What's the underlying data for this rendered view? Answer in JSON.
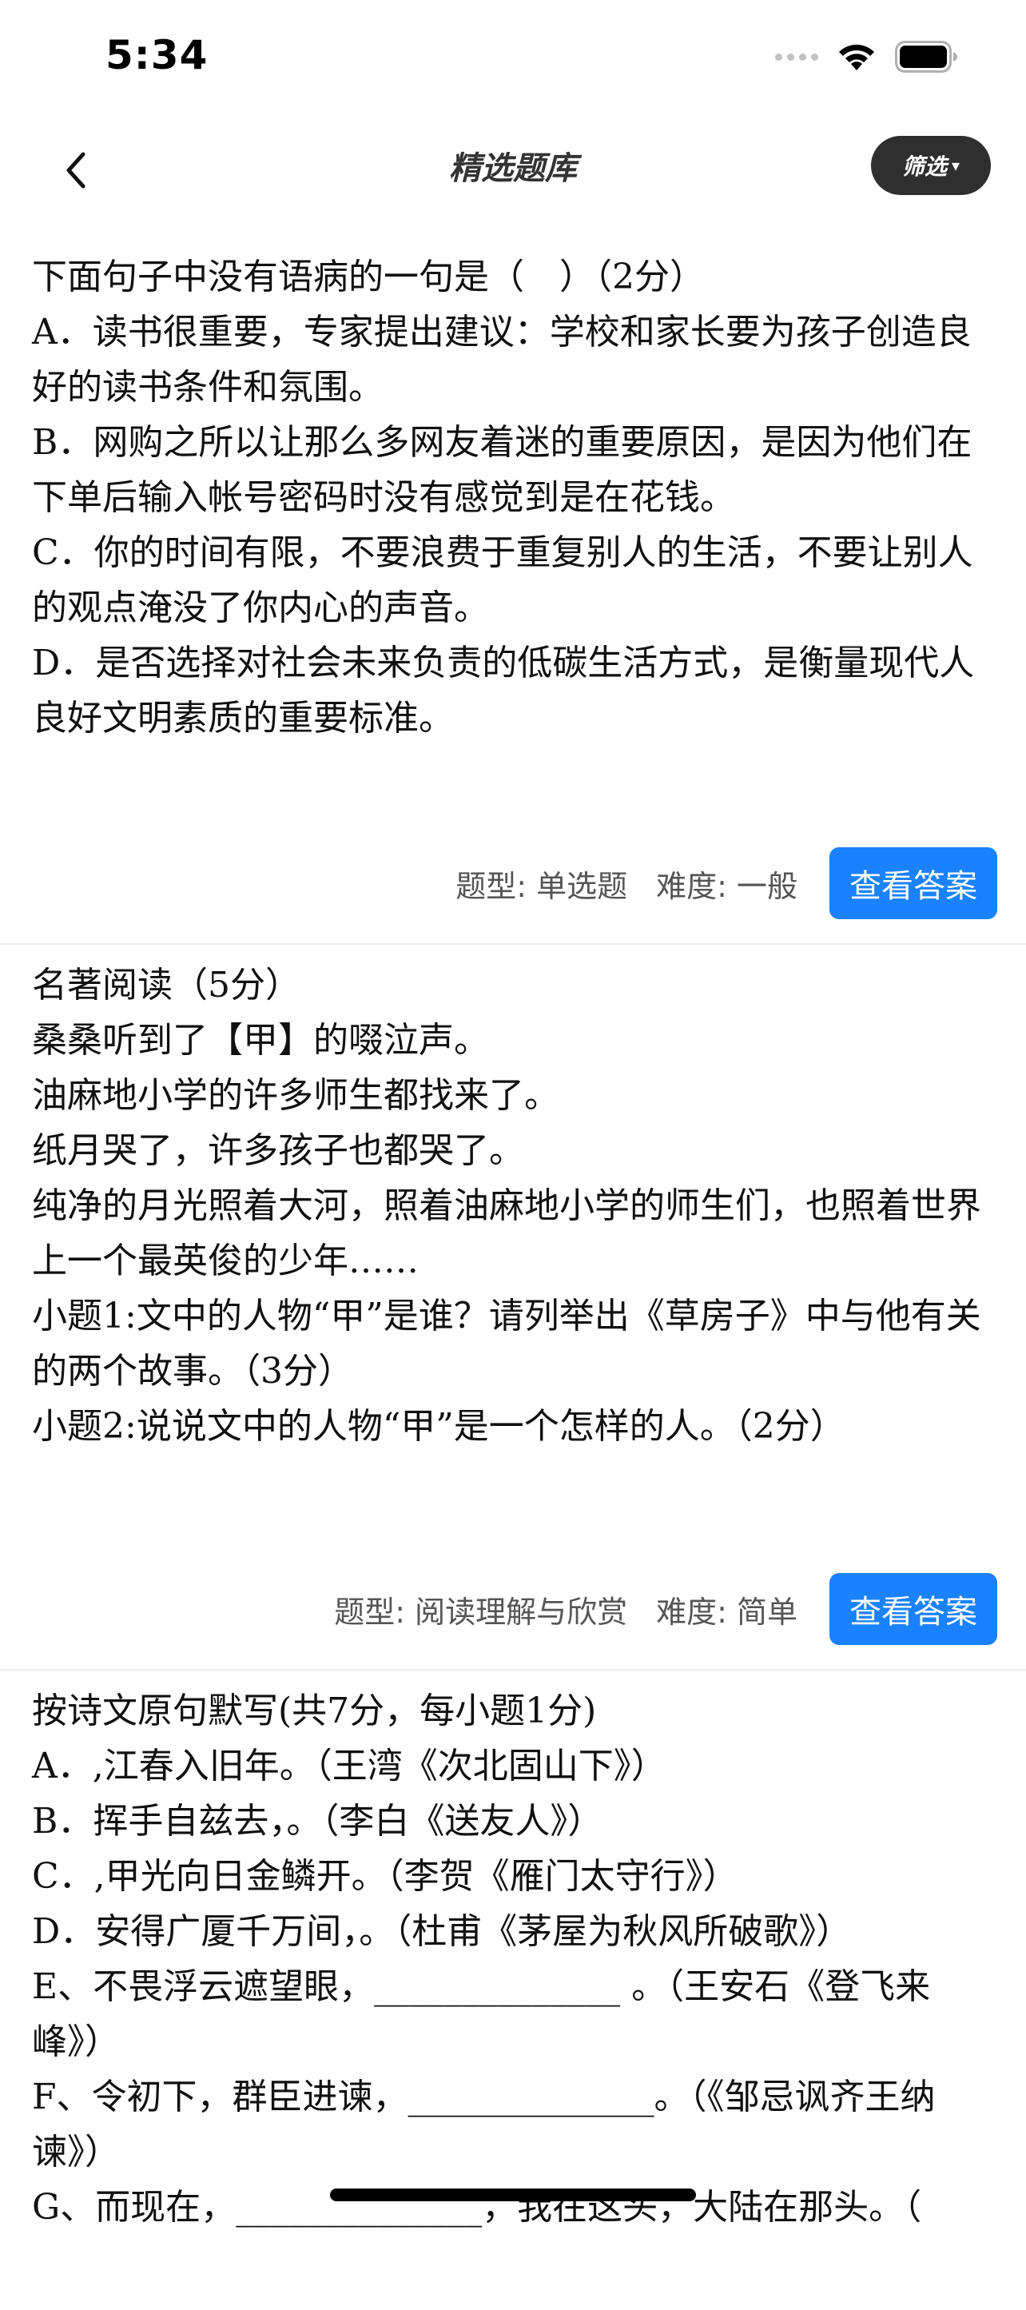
{
  "status_bar": {
    "time": "5:34"
  },
  "nav": {
    "title": "精选题库",
    "filter_label": "筛选",
    "filter_caret": "▾"
  },
  "questions": [
    {
      "lines": [
        "下面句子中没有语病的一句是（　）（2分）",
        "A．读书很重要，专家提出建议：学校和家长要为孩子创造良好的读书条件和氛围。",
        "B．网购之所以让那么多网友着迷的重要原因，是因为他们在下单后输入帐号密码时没有感觉到是在花钱。",
        "C．你的时间有限，不要浪费于重复别人的生活，不要让别人的观点淹没了你内心的声音。",
        "D．是否选择对社会未来负责的低碳生活方式，是衡量现代人良好文明素质的重要标准。"
      ],
      "type": "题型: 单选题",
      "difficulty": "难度: 一般",
      "answer_label": "查看答案"
    },
    {
      "lines": [
        "名著阅读（5分）",
        "桑桑听到了【甲】的啜泣声。",
        "油麻地小学的许多师生都找来了。",
        "纸月哭了，许多孩子也都哭了。",
        "纯净的月光照着大河，照着油麻地小学的师生们，也照着世界上一个最英俊的少年……",
        "小题1:文中的人物“甲”是谁？请列举出《草房子》中与他有关的两个故事。（3分）",
        "小题2:说说文中的人物“甲”是一个怎样的人。（2分）"
      ],
      "type": "题型: 阅读理解与欣赏",
      "difficulty": "难度: 简单",
      "answer_label": "查看答案"
    },
    {
      "lines": [
        "按诗文原句默写(共7分，每小题1分)",
        "A．,江春入旧年。（王湾《次北固山下》）",
        "B．挥手自兹去，。（李白《送友人》）",
        "C．,甲光向日金鳞开。（李贺《雁门太守行》）",
        "D．安得广厦千万间，。（杜甫《茅屋为秋风所破歌》）",
        "E、不畏浮云遮望眼，______________ 。（王安石《登飞来峰》）",
        "F、令初下，群臣进谏，______________。（《邹忌讽齐王纳谏》）",
        "G、而现在，______________，我在这头，大陆在那头。（"
      ]
    }
  ]
}
